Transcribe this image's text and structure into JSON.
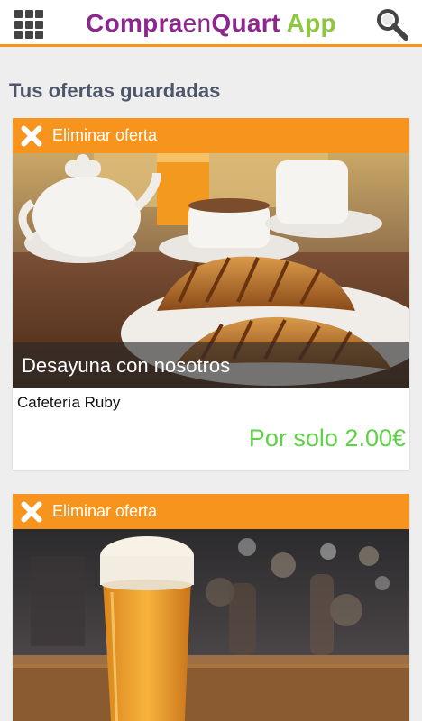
{
  "header": {
    "logo_part1": "Compra",
    "logo_part2": "en",
    "logo_part3": "Quart",
    "logo_part4": " App",
    "menu_icon": "grid-menu-icon",
    "search_icon": "search-icon"
  },
  "colors": {
    "accent_orange": "#f7941d",
    "brand_purple": "#8e2690",
    "brand_green": "#8dc63f",
    "price_green": "#5fd146"
  },
  "page": {
    "title": "Tus ofertas guardadas"
  },
  "offers": [
    {
      "remove_label": "Eliminar oferta",
      "title": "Desayuna con nosotros",
      "venue": "Cafetería Ruby",
      "price": "Por solo 2.00€",
      "image": "coffee-croissants-photo"
    },
    {
      "remove_label": "Eliminar oferta",
      "image": "beer-glass-photo"
    }
  ]
}
